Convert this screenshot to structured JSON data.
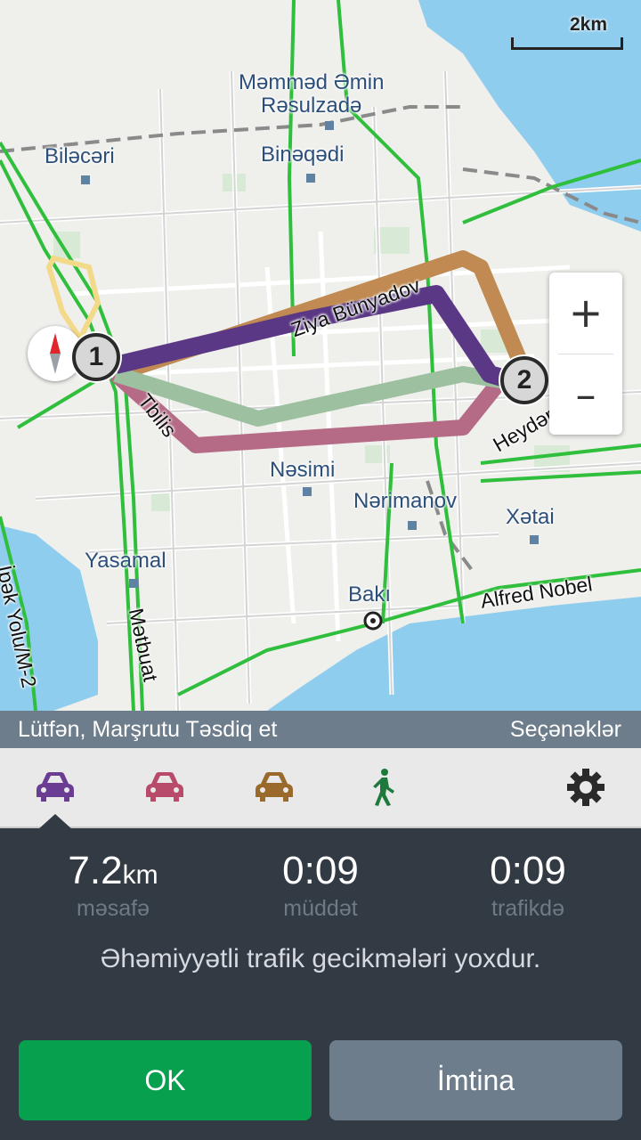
{
  "map": {
    "scale_label": "2km",
    "places": [
      {
        "name": "Məmməd Əmin\nRəsulzadə"
      },
      {
        "name": "Biləcəri"
      },
      {
        "name": "Binəqədi"
      },
      {
        "name": "Nəsimi"
      },
      {
        "name": "Nərimanov"
      },
      {
        "name": "Xətai"
      },
      {
        "name": "Yasamal"
      },
      {
        "name": "Bakı"
      }
    ],
    "roads": [
      "Ziya Bünyadov",
      "Tbilis",
      "Heydər Əliyev",
      "Alfred Nobel",
      "Mətbuat",
      "İpək Yolu/M-2"
    ],
    "waypoints": [
      "1",
      "2"
    ],
    "zoom_in": "+",
    "zoom_out": "–",
    "icons": {
      "compass": "compass-icon"
    }
  },
  "status": {
    "prompt": "Lütfən, Marşrutu Təsdiq et",
    "options": "Seçənəklər"
  },
  "modes": [
    {
      "icon": "car-icon",
      "color": "#6a3d93"
    },
    {
      "icon": "car-icon",
      "color": "#b84b6a"
    },
    {
      "icon": "car-icon",
      "color": "#9a6a2c"
    },
    {
      "icon": "walk-icon",
      "color": "#1e7a3c"
    },
    {
      "icon": "gear-icon",
      "color": "#2a2a2a"
    }
  ],
  "summary": {
    "distance": {
      "value": "7.2",
      "unit": "km",
      "label": "məsafə"
    },
    "duration": {
      "value": "0:09",
      "label": "müddət"
    },
    "traffic": {
      "value": "0:09",
      "label": "trafikdə"
    },
    "message": "Əhəmiyyətli trafik gecikmələri yoxdur."
  },
  "buttons": {
    "ok": "OK",
    "cancel": "İmtina"
  },
  "colors": {
    "route_primary": "#5b3885",
    "route_alt1": "#b56a86",
    "route_alt2": "#c08a52",
    "route_alt3": "#9cc0a0",
    "ok": "#07a04e"
  }
}
